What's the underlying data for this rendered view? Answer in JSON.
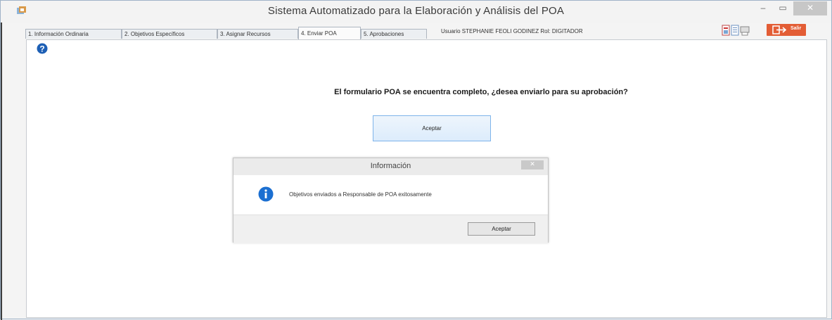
{
  "window": {
    "title": "Sistema Automatizado para la Elaboración y Análisis del POA",
    "minimize_glyph": "–",
    "maximize_glyph": "▭",
    "close_glyph": "✕"
  },
  "tabs": [
    {
      "label": "1. Información Ordinaria",
      "active": false
    },
    {
      "label": "2. Objetivos Específicos",
      "active": false
    },
    {
      "label": "3. Asignar Recursos",
      "active": false
    },
    {
      "label": "4. Enviar POA",
      "active": true
    },
    {
      "label": "5. Aprobaciones",
      "active": false
    }
  ],
  "user_info": "Usuario STEPHANIE FEOLI GODINEZ  Rol: DIGITADOR",
  "exit_button": {
    "label": "Salir",
    "color": "#e35d35"
  },
  "icons": {
    "app": "app-icon",
    "help": "help-icon",
    "toolbar": "toolbar-icons",
    "exit": "exit-icon",
    "info": "info-icon"
  },
  "main": {
    "question": "El formulario POA se encuentra completo, ¿desea enviarlo para su aprobación?",
    "accept_label": "Aceptar"
  },
  "dialog": {
    "title": "Información",
    "close_glyph": "✕",
    "message": "Objetivos enviados a Responsable de POA exitosamente",
    "accept_label": "Aceptar"
  }
}
